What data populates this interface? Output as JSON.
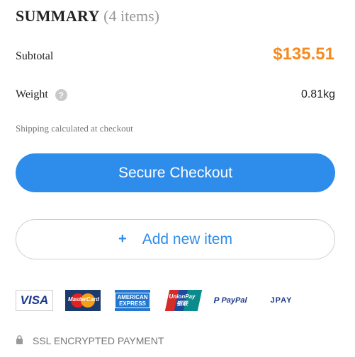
{
  "summary": {
    "title": "SUMMARY",
    "count": "(4 items)"
  },
  "subtotal": {
    "label": "Subtotal",
    "value": "$135.51"
  },
  "weight": {
    "label": "Weight",
    "help_icon": "?",
    "value": "0.81kg"
  },
  "shipping_note": "Shipping calculated at checkout",
  "checkout_button": "Secure Checkout",
  "add_button": {
    "plus": "+",
    "label": "Add new item"
  },
  "payment_methods": {
    "visa": "VISA",
    "mastercard": "MasterCard",
    "amex_line1": "AMERICAN",
    "amex_line2": "EXPRESS",
    "unionpay_line1": "UnionPay",
    "unionpay_line2": "银联",
    "paypal": "PayPal",
    "jpay": "JPAY"
  },
  "ssl_note": "SSL ENCRYPTED PAYMENT",
  "colors": {
    "accent_blue": "#2e8ceb",
    "price_orange": "#f58a1f"
  }
}
